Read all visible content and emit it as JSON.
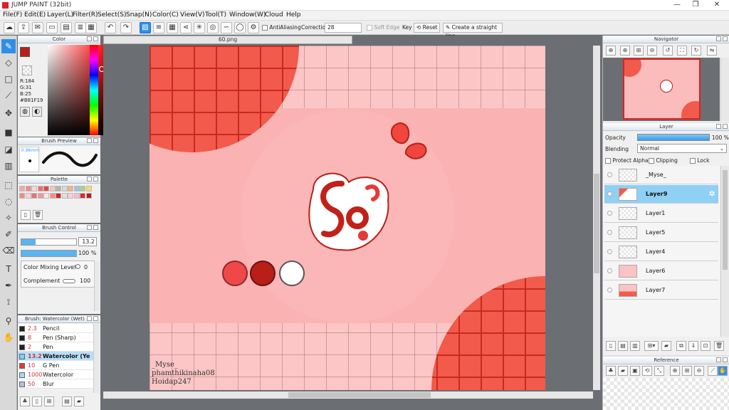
{
  "window": {
    "title": "JUMP PAINT (32bit)",
    "minimize": "—",
    "maximize": "❐",
    "close": "✕"
  },
  "menu": [
    "File(F)",
    "Edit(E)",
    "Layer(L)",
    "Filter(R)",
    "Select(S)",
    "Snap(N)",
    "Color(C)",
    "View(V)",
    "Tool(T)",
    "Window(W)",
    "Cloud",
    "Help"
  ],
  "toolbar": {
    "antialiasing_label": "AntiAliasing",
    "correction_label": "Correction",
    "correction_value": "28",
    "soft_edge_label": "Soft Edge",
    "key_label": "Key",
    "reset_label": "Reset",
    "straight_line_label": "Create a straight line"
  },
  "color_panel": {
    "title": "Color",
    "r": "R:184",
    "g": "G:31",
    "b": "B:25",
    "hex": "#B81F19",
    "foreground": "#b81f19"
  },
  "brush_preview": {
    "title": "Brush Preview",
    "size": "0.96mm"
  },
  "palette": {
    "title": "Palette",
    "swatches": [
      "#f7a6a6",
      "#f48a8a",
      "#fbd3d3",
      "#f56c6c",
      "#e04848",
      "#f8c4c4",
      "#b3b3b3",
      "#d9d9d9",
      "#f4b183",
      "#9dc3e6",
      "#a9d18e",
      "#ffd966",
      "#f28b82",
      "#fcd5d5",
      "#e57373",
      "#ef9a9a",
      "#fce4ec",
      "#ff8a80",
      "#c62828",
      "#e0e0e0",
      "#ffcdd2",
      "#f8bbd0",
      "#d32f2f",
      "#b71c1c"
    ]
  },
  "brush_control": {
    "title": "Brush Control",
    "size_value": "13.2",
    "opacity_value": "100 %",
    "mixing_label": "Color Mixing Level",
    "mixing_value": "0",
    "complement_label": "Complement",
    "complement_value": "100"
  },
  "brush_list": {
    "title": "Brush: Watercolor (Wet)",
    "items": [
      {
        "size": "2.3",
        "name": "Pencil",
        "color": "#222222"
      },
      {
        "size": "8",
        "name": "Pen (Sharp)",
        "color": "#222222"
      },
      {
        "size": "2",
        "name": "Pen",
        "color": "#222222"
      },
      {
        "size": "13.2",
        "name": "Watercolor (Ye",
        "color": "#7ecff2"
      },
      {
        "size": "10",
        "name": "G Pen",
        "color": "#e53935"
      },
      {
        "size": "1000",
        "name": "Watercolor",
        "color": "#9fd8f7"
      },
      {
        "size": "50",
        "name": "Blur",
        "color": "#b9b9e8"
      }
    ]
  },
  "document": {
    "tab": "60.png"
  },
  "artwork": {
    "credit_lines": [
      "_Myse_",
      "phamthikinaha08",
      "Hoidap247"
    ],
    "swatch_colors": [
      "#f04848",
      "#b81f19",
      "#ffffff"
    ],
    "logo_text": "Sợ"
  },
  "navigator": {
    "title": "Navigator"
  },
  "layer_panel": {
    "title": "Layer",
    "opacity_label": "Opacity",
    "opacity_value": "100 %",
    "blending_label": "Blending",
    "blending_value": "Normal",
    "protect_alpha_label": "Protect Alpha",
    "clipping_label": "Clipping",
    "lock_label": "Lock",
    "layers": [
      {
        "name": "_Myse_",
        "selected": false
      },
      {
        "name": "Layer9",
        "selected": true
      },
      {
        "name": "Layer1",
        "selected": false
      },
      {
        "name": "Layer5",
        "selected": false
      },
      {
        "name": "Layer4",
        "selected": false
      },
      {
        "name": "Layer6",
        "selected": false
      },
      {
        "name": "Layer7",
        "selected": false
      }
    ]
  },
  "reference": {
    "title": "Reference"
  }
}
